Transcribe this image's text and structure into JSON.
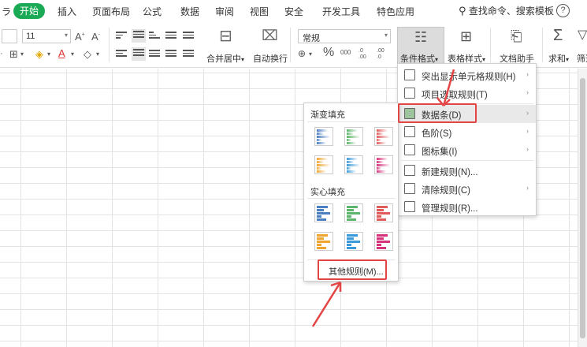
{
  "menubar": {
    "tabs": [
      "开始",
      "插入",
      "页面布局",
      "公式",
      "数据",
      "审阅",
      "视图",
      "安全",
      "开发工具",
      "特色应用"
    ],
    "search_label": "查找命令、搜索模板",
    "help": "?"
  },
  "toolbar": {
    "font_size": "11",
    "merge_label": "合并居中",
    "wrap_label": "自动换行",
    "number_format": "常规",
    "percent": "%",
    "thousands": "000",
    "dec_inc": ".0 .00",
    "dec_dec": ".00 .0",
    "cond_format_label": "条件格式",
    "table_style_label": "表格样式",
    "doc_helper_label": "文档助手",
    "sum_label": "求和",
    "filter_label": "筛选"
  },
  "cf_menu": {
    "items": [
      {
        "label": "突出显示单元格规则(H)",
        "arrow": true
      },
      {
        "label": "项目选取规则(T)",
        "arrow": true
      },
      {
        "label": "数据条(D)",
        "arrow": true,
        "highlighted": true
      },
      {
        "label": "色阶(S)",
        "arrow": true
      },
      {
        "label": "图标集(I)",
        "arrow": true
      },
      {
        "label": "新建规则(N)...",
        "arrow": false
      },
      {
        "label": "清除规则(C)",
        "arrow": true
      },
      {
        "label": "管理规则(R)...",
        "arrow": false
      }
    ]
  },
  "databar_submenu": {
    "gradient_title": "渐变填充",
    "solid_title": "实心填充",
    "colors": [
      "#4a7fc1",
      "#5bb56a",
      "#e15b5b",
      "#f0a531",
      "#3a9ad9",
      "#d6337c"
    ],
    "other_rules": "其他规则(M)..."
  },
  "colors": {
    "accent": "#1aaa55",
    "highlight_box": "#e34545"
  }
}
